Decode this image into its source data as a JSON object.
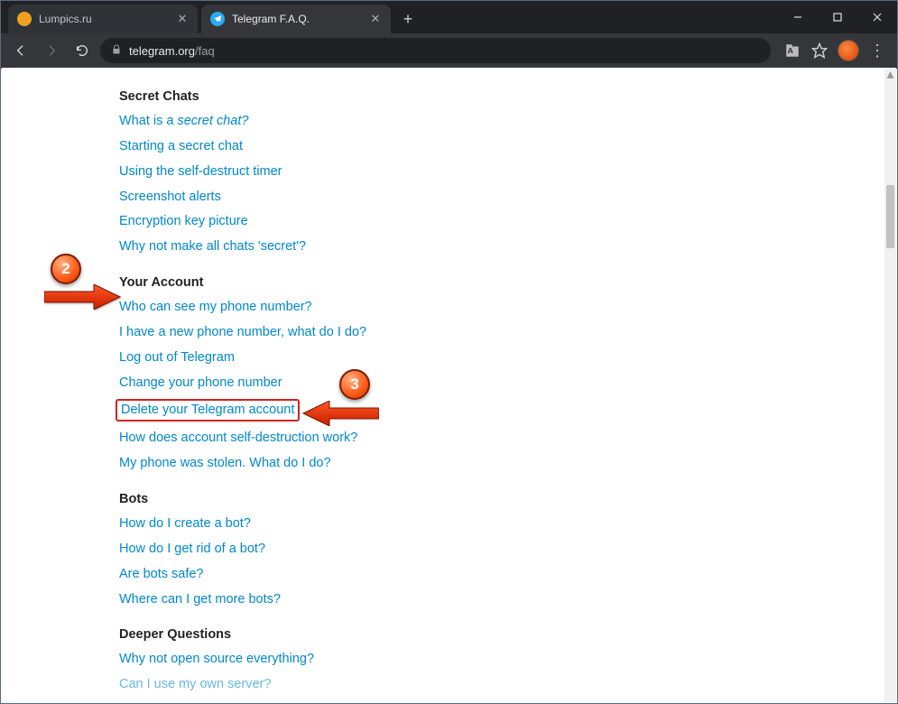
{
  "window": {
    "tabs": [
      {
        "title": "Lumpics.ru",
        "favicon_color": "#f0a020",
        "active": false
      },
      {
        "title": "Telegram F.A.Q.",
        "favicon_color": "#2aabee",
        "active": true
      }
    ]
  },
  "address": {
    "host": "telegram.org",
    "path": "/faq"
  },
  "icons": {
    "translate": "translate-icon",
    "star": "star-icon"
  },
  "faq": {
    "sections": [
      {
        "title": "Secret Chats",
        "links": [
          {
            "html": "What is a <em>secret chat?</em>"
          },
          {
            "text": "Starting a secret chat"
          },
          {
            "text": "Using the self-destruct timer"
          },
          {
            "text": "Screenshot alerts"
          },
          {
            "text": "Encryption key picture"
          },
          {
            "text": "Why not make all chats 'secret'?"
          }
        ]
      },
      {
        "title": "Your Account",
        "links": [
          {
            "text": "Who can see my phone number?"
          },
          {
            "text": "I have a new phone number, what do I do?"
          },
          {
            "text": "Log out of Telegram"
          },
          {
            "text": "Change your phone number"
          },
          {
            "text": "Delete your Telegram account",
            "highlight": true
          },
          {
            "text": "How does account self-destruction work?"
          },
          {
            "text": "My phone was stolen. What do I do?"
          }
        ]
      },
      {
        "title": "Bots",
        "links": [
          {
            "text": "How do I create a bot?"
          },
          {
            "text": "How do I get rid of a bot?"
          },
          {
            "text": "Are bots safe?"
          },
          {
            "text": "Where can I get more bots?"
          }
        ]
      },
      {
        "title": "Deeper Questions",
        "links": [
          {
            "text": "Why not open source everything?"
          },
          {
            "text": "Can I use my own server?"
          }
        ]
      }
    ]
  },
  "annotations": {
    "badge2": "2",
    "badge3": "3"
  }
}
